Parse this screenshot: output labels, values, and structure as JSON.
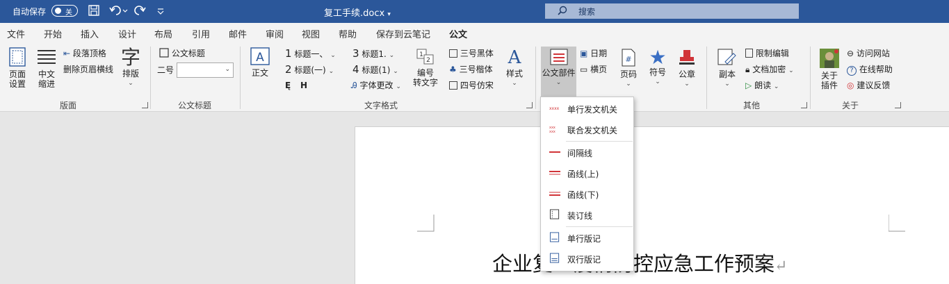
{
  "titlebar": {
    "autosave_label": "自动保存",
    "autosave_state": "关",
    "document_title": "复工手续.docx",
    "search_placeholder": "搜索"
  },
  "tabs": [
    {
      "label": "文件"
    },
    {
      "label": "开始"
    },
    {
      "label": "插入"
    },
    {
      "label": "设计"
    },
    {
      "label": "布局"
    },
    {
      "label": "引用"
    },
    {
      "label": "邮件"
    },
    {
      "label": "审阅"
    },
    {
      "label": "视图"
    },
    {
      "label": "帮助"
    },
    {
      "label": "保存到云笔记"
    },
    {
      "label": "公文",
      "active": true
    }
  ],
  "ribbon": {
    "banmian": {
      "group_label": "版面",
      "page_setup": "页面\n设置",
      "page_setup_l1": "页面",
      "page_setup_l2": "设置",
      "cn_indent_l1": "中文",
      "cn_indent_l2": "缩进",
      "para_top": "段落顶格",
      "del_header_line": "删除页眉横线",
      "typeset": "排版"
    },
    "title_group": {
      "group_label": "公文标题",
      "title_btn": "公文标题",
      "size_label": "二号",
      "size_value": ""
    },
    "text_format": {
      "group_label": "文字格式",
      "body": "正文",
      "h1": "标题一、",
      "h2": "标题(一)",
      "h3": "标题1.",
      "h4": "标题(1)",
      "font_change": "字体更改",
      "num_l1": "编号",
      "num_l2": "转文字",
      "hei": "三号黑体",
      "kai": "三号楷体",
      "fang": "四号仿宋",
      "style": "样式"
    },
    "parts": {
      "label": "公文部件",
      "date": "日期",
      "hline": "横页",
      "page_num": "页码",
      "symbol": "符号",
      "seal": "公章"
    },
    "other": {
      "group_label": "其他",
      "copy": "副本",
      "restrict": "限制编辑",
      "encrypt": "文档加密",
      "read": "朗读"
    },
    "about": {
      "group_label": "关于",
      "about_l1": "关于",
      "about_l2": "插件",
      "visit": "访问网站",
      "help": "在线帮助",
      "feedback": "建议反馈"
    }
  },
  "menu": {
    "items": [
      {
        "label": "单行发文机关",
        "icon": "single-issuer-icon"
      },
      {
        "label": "联合发文机关",
        "icon": "joint-issuer-icon"
      },
      {
        "label": "间隔线",
        "icon": "separator-line-icon"
      },
      {
        "label": "函线(上)",
        "icon": "letter-line-top-icon"
      },
      {
        "label": "函线(下)",
        "icon": "letter-line-bottom-icon"
      },
      {
        "label": "装订线",
        "icon": "binding-line-icon"
      },
      {
        "label": "单行版记",
        "icon": "single-colophon-icon"
      },
      {
        "label": "双行版记",
        "icon": "double-colophon-icon"
      }
    ]
  },
  "document": {
    "heading": "企业复工疫情防控应急工作预案"
  },
  "colors": {
    "titlebar": "#2b579a",
    "accent_red": "#d13438",
    "icon_blue": "#2b579a"
  }
}
